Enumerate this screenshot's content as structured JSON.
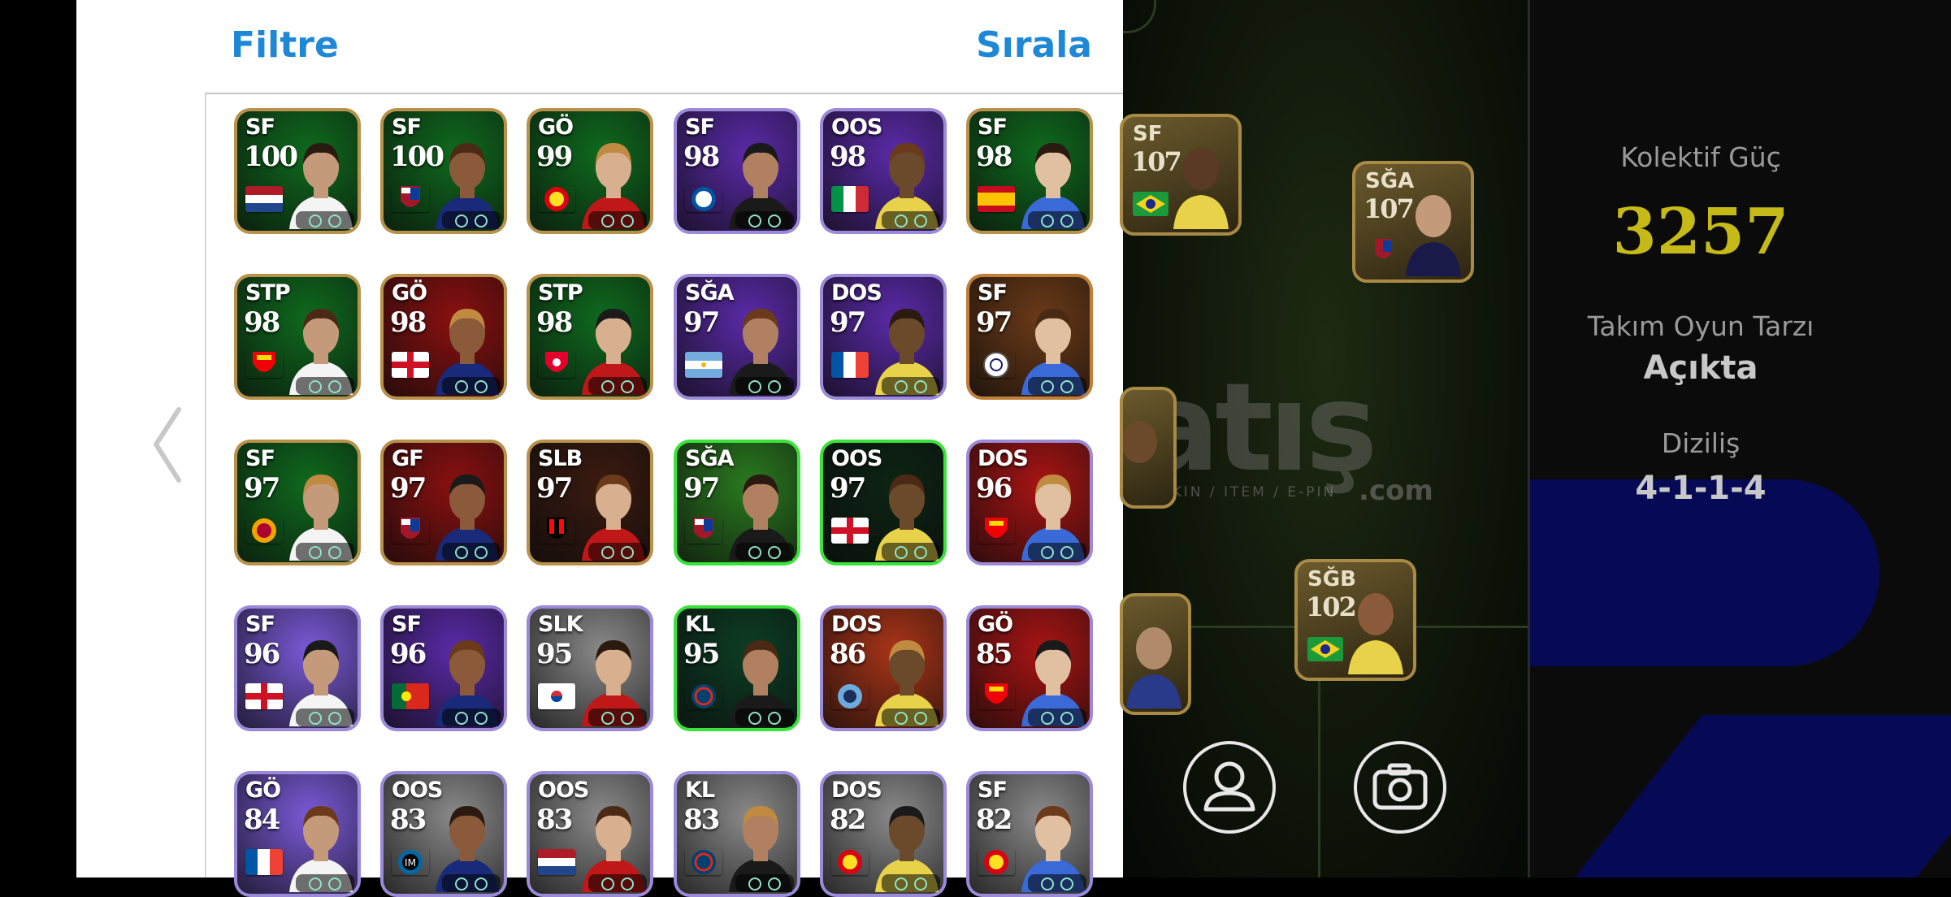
{
  "header": {
    "filter_label": "Filtre",
    "sort_label": "Sırala"
  },
  "cards": [
    {
      "pos": "SF",
      "rating": "100",
      "bg": "#0f6a1e",
      "frame": "#b8914a",
      "flag": "netherlands"
    },
    {
      "pos": "SF",
      "rating": "100",
      "bg": "#0f6a1e",
      "frame": "#b8914a",
      "flag": "barcelona"
    },
    {
      "pos": "GÖ",
      "rating": "99",
      "bg": "#0f6a1e",
      "frame": "#b8914a",
      "flag": "manutd"
    },
    {
      "pos": "SF",
      "rating": "98",
      "bg": "#5a2aa8",
      "frame": "#9a8ad8",
      "flag": "leicester"
    },
    {
      "pos": "OOS",
      "rating": "98",
      "bg": "#5a2aa8",
      "frame": "#9a8ad8",
      "flag": "italy"
    },
    {
      "pos": "SF",
      "rating": "98",
      "bg": "#0f6a1e",
      "frame": "#b8914a",
      "flag": "spain"
    },
    {
      "pos": "STP",
      "rating": "98",
      "bg": "#0f6a1e",
      "frame": "#b8914a",
      "flag": "arsenal"
    },
    {
      "pos": "GÖ",
      "rating": "98",
      "bg": "#8a1010",
      "frame": "#b8914a",
      "flag": "england"
    },
    {
      "pos": "STP",
      "rating": "98",
      "bg": "#0f6a1e",
      "frame": "#b8914a",
      "flag": "club-red"
    },
    {
      "pos": "SĞA",
      "rating": "97",
      "bg": "#5a2aa8",
      "frame": "#9a8ad8",
      "flag": "argentina"
    },
    {
      "pos": "DOS",
      "rating": "97",
      "bg": "#5a2aa8",
      "frame": "#9a8ad8",
      "flag": "france"
    },
    {
      "pos": "SF",
      "rating": "97",
      "bg": "#6b3a18",
      "frame": "#c0803a",
      "flag": "realmadrid"
    },
    {
      "pos": "SF",
      "rating": "97",
      "bg": "#0f6a1e",
      "frame": "#b8914a",
      "flag": "galatasaray"
    },
    {
      "pos": "GF",
      "rating": "97",
      "bg": "#8a1010",
      "frame": "#b8914a",
      "flag": "barcelona"
    },
    {
      "pos": "SLB",
      "rating": "97",
      "bg": "#3a1a10",
      "frame": "#b8914a",
      "flag": "milan"
    },
    {
      "pos": "SĞA",
      "rating": "97",
      "bg": "#2a7a20",
      "frame": "#3ce23c",
      "flag": "barcelona"
    },
    {
      "pos": "OOS",
      "rating": "97",
      "bg": "#0c2414",
      "frame": "#3ce23c",
      "flag": "england"
    },
    {
      "pos": "DOS",
      "rating": "96",
      "bg": "#a81414",
      "frame": "#9a8ad8",
      "flag": "arsenal"
    },
    {
      "pos": "SF",
      "rating": "96",
      "bg": "#7a5ad8",
      "frame": "#9a8ad8",
      "flag": "england"
    },
    {
      "pos": "SF",
      "rating": "96",
      "bg": "#5a2aa8",
      "frame": "#9a8ad8",
      "flag": "portugal"
    },
    {
      "pos": "SLK",
      "rating": "95",
      "bg": "#8a8a8a",
      "frame": "#9a8ad8",
      "flag": "korea"
    },
    {
      "pos": "KL",
      "rating": "95",
      "bg": "#0d3d24",
      "frame": "#3ce23c",
      "flag": "psg"
    },
    {
      "pos": "DOS",
      "rating": "86",
      "bg": "#a83418",
      "frame": "#9a8ad8",
      "flag": "mancity"
    },
    {
      "pos": "GÖ",
      "rating": "85",
      "bg": "#a81414",
      "frame": "#9a8ad8",
      "flag": "arsenal"
    },
    {
      "pos": "GÖ",
      "rating": "84",
      "bg": "#7a5ad8",
      "frame": "#9a8ad8",
      "flag": "france"
    },
    {
      "pos": "OOS",
      "rating": "83",
      "bg": "#8a8a8a",
      "frame": "#9a8ad8",
      "flag": "inter"
    },
    {
      "pos": "OOS",
      "rating": "83",
      "bg": "#8a8a8a",
      "frame": "#9a8ad8",
      "flag": "netherlands"
    },
    {
      "pos": "KL",
      "rating": "83",
      "bg": "#8a8a8a",
      "frame": "#9a8ad8",
      "flag": "psg"
    },
    {
      "pos": "DOS",
      "rating": "82",
      "bg": "#8a8a8a",
      "frame": "#9a8ad8",
      "flag": "manutd"
    },
    {
      "pos": "SF",
      "rating": "82",
      "bg": "#8a8a8a",
      "frame": "#9a8ad8",
      "flag": "manutd"
    }
  ],
  "pitch": {
    "cards": [
      {
        "pos": "SF",
        "rating": "107",
        "flag": "brazil"
      },
      {
        "pos": "SĞA",
        "rating": "107",
        "flag": "barcelona"
      },
      {
        "pos": "SĞB",
        "rating": "102",
        "flag": "brazil"
      }
    ],
    "watermark": "atış",
    "watermark_sub": "P / SKIN / ITEM / E-PIN",
    "watermark_com": ".com"
  },
  "info": {
    "power_label": "Kolektif Güç",
    "power_value": "3257",
    "style_label": "Takım Oyun Tarzı",
    "style_value": "Açıkta",
    "formation_label": "Diziliş",
    "formation_value": "4-1-1-4"
  },
  "colors": {
    "accent_blue": "#1e88d6",
    "power_yellow": "#c6ba18",
    "info_blue": "#060a55"
  }
}
